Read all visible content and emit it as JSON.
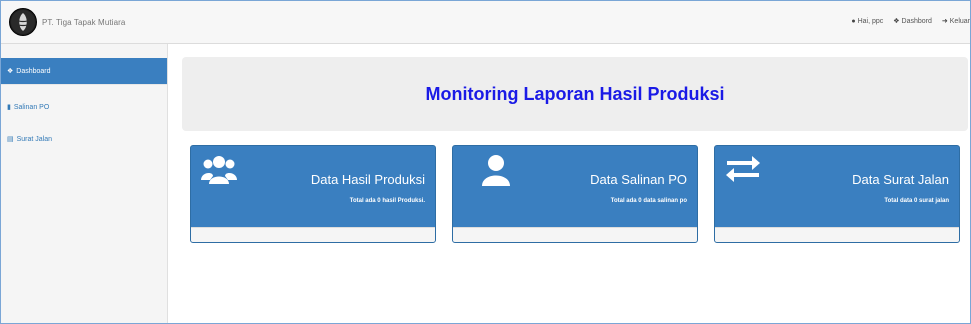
{
  "brand": {
    "name": "PT. Tiga Tapak Mutiara"
  },
  "navbar": {
    "links": [
      {
        "icon": "user-icon",
        "label": "Hai, ppc"
      },
      {
        "icon": "dashboard-icon",
        "label": "Dashbord"
      },
      {
        "icon": "logout-icon",
        "label": "Keluar"
      }
    ]
  },
  "sidebar": {
    "items": [
      {
        "icon": "dashboard-icon",
        "label": "Dashboard",
        "active": true
      },
      {
        "icon": "book-icon",
        "label": "Salinan PO"
      },
      {
        "icon": "list-icon",
        "label": "Surat Jalan"
      }
    ]
  },
  "main": {
    "heading": "Monitoring Laporan Hasil Produksi",
    "cards": [
      {
        "icon": "users-icon",
        "title": "Data Hasil Produksi",
        "subtitle": "Total ada 0 hasil Produksi."
      },
      {
        "icon": "user-icon",
        "title": "Data Salinan PO",
        "subtitle": "Total ada 0 data salinan po"
      },
      {
        "icon": "exchange-icon",
        "title": "Data Surat Jalan",
        "subtitle": "Total data 0 surat jalan"
      }
    ]
  },
  "colors": {
    "primary": "#3a7fc0",
    "heading": "#1a1ae6",
    "jumbotron": "#eeeeee",
    "sidebar": "#f5f5f5"
  }
}
